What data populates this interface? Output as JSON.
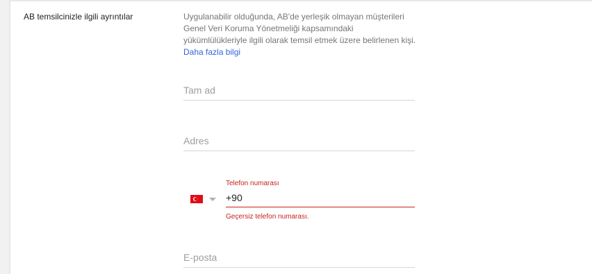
{
  "section": {
    "title": "AB temsilcinizle ilgili ayrıntılar",
    "description_text": "Uygulanabilir olduğunda, AB'de yerleşik olmayan müşterileri Genel Veri Koruma Yönetmeliği kapsamındaki yükümlülükleriyle ilgili olarak temsil etmek üzere belirlenen kişi.",
    "learn_more_link": "Daha fazla bilgi"
  },
  "fields": {
    "full_name_placeholder": "Tam ad",
    "address_placeholder": "Adres",
    "email_placeholder": "E-posta"
  },
  "phone": {
    "label": "Telefon numarası",
    "value": "+90",
    "error": "Geçersiz telefon numarası.",
    "country_flag": "turkey-flag-icon"
  },
  "colors": {
    "error": "#c5221f",
    "link": "#3367d6",
    "flag_red": "#e30a17"
  }
}
